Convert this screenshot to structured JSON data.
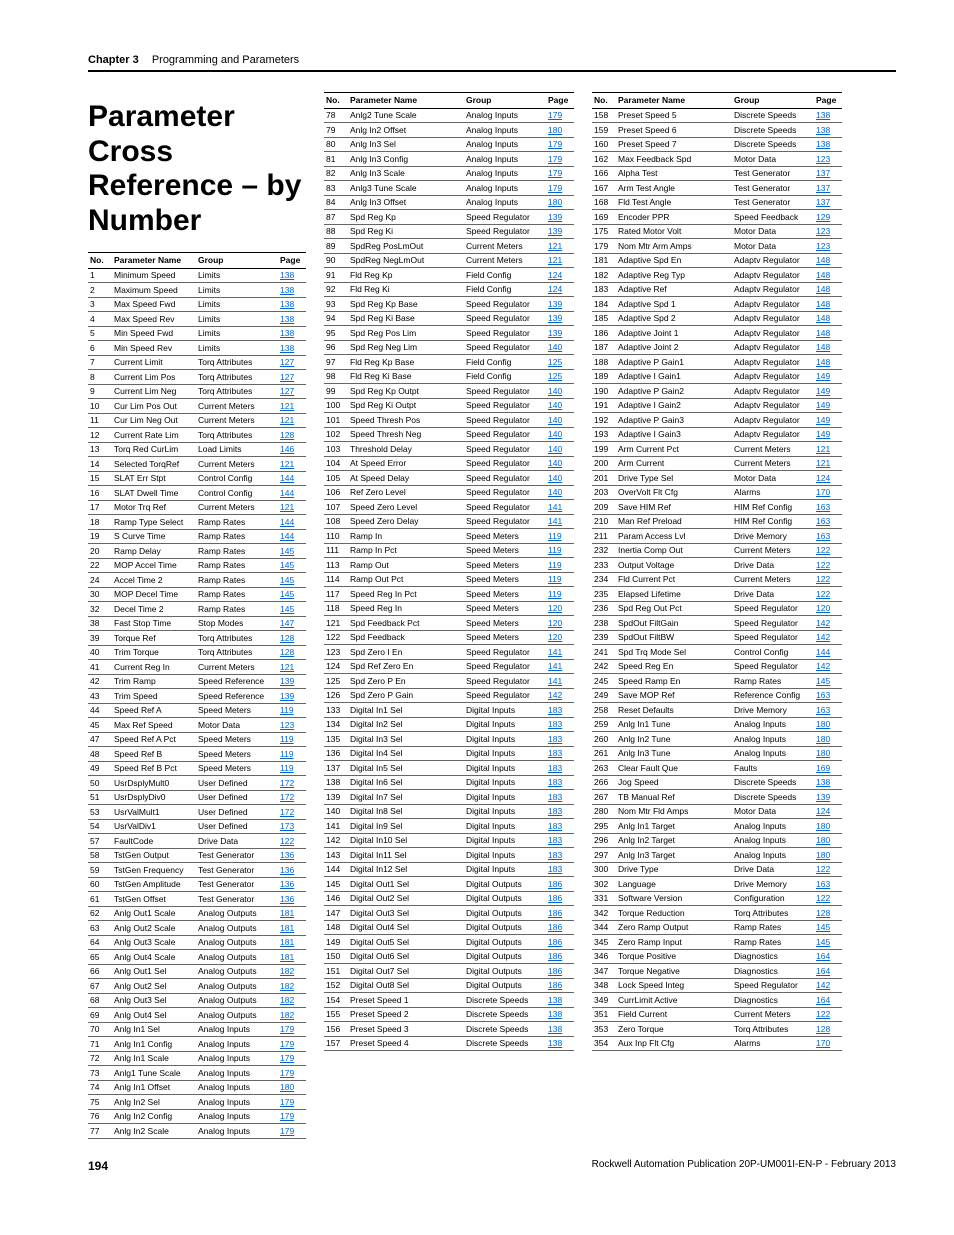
{
  "header": {
    "chapter": "Chapter 3",
    "section": "Programming and Parameters"
  },
  "title": "Parameter Cross Reference – by Number",
  "columns": {
    "no": "No.",
    "name": "Parameter Name",
    "group": "Group",
    "page": "Page"
  },
  "footer": {
    "page": "194",
    "pub": "Rockwell Automation Publication 20P-UM001I-EN-P - February 2013"
  },
  "tables": [
    [
      [
        "1",
        "Minimum Speed",
        "Limits",
        "138"
      ],
      [
        "2",
        "Maximum Speed",
        "Limits",
        "138"
      ],
      [
        "3",
        "Max Speed Fwd",
        "Limits",
        "138"
      ],
      [
        "4",
        "Max Speed Rev",
        "Limits",
        "138"
      ],
      [
        "5",
        "Min Speed Fwd",
        "Limits",
        "138"
      ],
      [
        "6",
        "Min Speed Rev",
        "Limits",
        "138"
      ],
      [
        "7",
        "Current Limit",
        "Torq Attributes",
        "127"
      ],
      [
        "8",
        "Current Lim Pos",
        "Torq Attributes",
        "127"
      ],
      [
        "9",
        "Current Lim Neg",
        "Torq Attributes",
        "127"
      ],
      [
        "10",
        "Cur Lim Pos Out",
        "Current Meters",
        "121"
      ],
      [
        "11",
        "Cur Lim Neg Out",
        "Current Meters",
        "121"
      ],
      [
        "12",
        "Current Rate Lim",
        "Torq Attributes",
        "128"
      ],
      [
        "13",
        "Torq Red CurLim",
        "Load Limits",
        "146"
      ],
      [
        "14",
        "Selected TorqRef",
        "Current Meters",
        "121"
      ],
      [
        "15",
        "SLAT Err Stpt",
        "Control Config",
        "144"
      ],
      [
        "16",
        "SLAT Dwell Time",
        "Control Config",
        "144"
      ],
      [
        "17",
        "Motor Trq Ref",
        "Current Meters",
        "121"
      ],
      [
        "18",
        "Ramp Type Select",
        "Ramp Rates",
        "144"
      ],
      [
        "19",
        "S Curve Time",
        "Ramp Rates",
        "144"
      ],
      [
        "20",
        "Ramp Delay",
        "Ramp Rates",
        "145"
      ],
      [
        "22",
        "MOP Accel Time",
        "Ramp Rates",
        "145"
      ],
      [
        "24",
        "Accel Time 2",
        "Ramp Rates",
        "145"
      ],
      [
        "30",
        "MOP Decel Time",
        "Ramp Rates",
        "145"
      ],
      [
        "32",
        "Decel Time 2",
        "Ramp Rates",
        "145"
      ],
      [
        "38",
        "Fast Stop Time",
        "Stop Modes",
        "147"
      ],
      [
        "39",
        "Torque Ref",
        "Torq Attributes",
        "128"
      ],
      [
        "40",
        "Trim Torque",
        "Torq Attributes",
        "128"
      ],
      [
        "41",
        "Current Reg In",
        "Current Meters",
        "121"
      ],
      [
        "42",
        "Trim Ramp",
        "Speed Reference",
        "139"
      ],
      [
        "43",
        "Trim Speed",
        "Speed Reference",
        "139"
      ],
      [
        "44",
        "Speed Ref A",
        "Speed Meters",
        "119"
      ],
      [
        "45",
        "Max Ref Speed",
        "Motor Data",
        "123"
      ],
      [
        "47",
        "Speed Ref A Pct",
        "Speed Meters",
        "119"
      ],
      [
        "48",
        "Speed Ref B",
        "Speed Meters",
        "119"
      ],
      [
        "49",
        "Speed Ref B Pct",
        "Speed Meters",
        "119"
      ],
      [
        "50",
        "UsrDsplyMult0",
        "User Defined",
        "172"
      ],
      [
        "51",
        "UsrDsplyDiv0",
        "User Defined",
        "172"
      ],
      [
        "53",
        "UsrValMult1",
        "User Defined",
        "172"
      ],
      [
        "54",
        "UsrValDiv1",
        "User Defined",
        "173"
      ],
      [
        "57",
        "FaultCode",
        "Drive Data",
        "122"
      ],
      [
        "58",
        "TstGen Output",
        "Test Generator",
        "136"
      ],
      [
        "59",
        "TstGen Frequency",
        "Test Generator",
        "136"
      ],
      [
        "60",
        "TstGen Amplitude",
        "Test Generator",
        "136"
      ],
      [
        "61",
        "TstGen Offset",
        "Test Generator",
        "136"
      ],
      [
        "62",
        "Anlg Out1 Scale",
        "Analog Outputs",
        "181"
      ],
      [
        "63",
        "Anlg Out2 Scale",
        "Analog Outputs",
        "181"
      ],
      [
        "64",
        "Anlg Out3 Scale",
        "Analog Outputs",
        "181"
      ],
      [
        "65",
        "Anlg Out4 Scale",
        "Analog Outputs",
        "181"
      ],
      [
        "66",
        "Anlg Out1 Sel",
        "Analog Outputs",
        "182"
      ],
      [
        "67",
        "Anlg Out2 Sel",
        "Analog Outputs",
        "182"
      ],
      [
        "68",
        "Anlg Out3 Sel",
        "Analog Outputs",
        "182"
      ],
      [
        "69",
        "Anlg Out4 Sel",
        "Analog Outputs",
        "182"
      ],
      [
        "70",
        "Anlg In1 Sel",
        "Analog Inputs",
        "179"
      ],
      [
        "71",
        "Anlg In1 Config",
        "Analog Inputs",
        "179"
      ],
      [
        "72",
        "Anlg In1 Scale",
        "Analog Inputs",
        "179"
      ],
      [
        "73",
        "Anlg1 Tune Scale",
        "Analog Inputs",
        "179"
      ],
      [
        "74",
        "Anlg In1 Offset",
        "Analog Inputs",
        "180"
      ],
      [
        "75",
        "Anlg In2 Sel",
        "Analog Inputs",
        "179"
      ],
      [
        "76",
        "Anlg In2 Config",
        "Analog Inputs",
        "179"
      ],
      [
        "77",
        "Anlg In2 Scale",
        "Analog Inputs",
        "179"
      ]
    ],
    [
      [
        "78",
        "Anlg2 Tune Scale",
        "Analog Inputs",
        "179"
      ],
      [
        "79",
        "Anlg In2 Offset",
        "Analog Inputs",
        "180"
      ],
      [
        "80",
        "Anlg In3 Sel",
        "Analog Inputs",
        "179"
      ],
      [
        "81",
        "Anlg In3 Config",
        "Analog Inputs",
        "179"
      ],
      [
        "82",
        "Anlg In3 Scale",
        "Analog Inputs",
        "179"
      ],
      [
        "83",
        "Anlg3 Tune Scale",
        "Analog Inputs",
        "179"
      ],
      [
        "84",
        "Anlg In3 Offset",
        "Analog Inputs",
        "180"
      ],
      [
        "87",
        "Spd Reg Kp",
        "Speed Regulator",
        "139"
      ],
      [
        "88",
        "Spd Reg Ki",
        "Speed Regulator",
        "139"
      ],
      [
        "89",
        "SpdReg PosLmOut",
        "Current Meters",
        "121"
      ],
      [
        "90",
        "SpdReg NegLmOut",
        "Current Meters",
        "121"
      ],
      [
        "91",
        "Fld Reg Kp",
        "Field Config",
        "124"
      ],
      [
        "92",
        "Fld Reg Ki",
        "Field Config",
        "124"
      ],
      [
        "93",
        "Spd Reg Kp Base",
        "Speed Regulator",
        "139"
      ],
      [
        "94",
        "Spd Reg Ki Base",
        "Speed Regulator",
        "139"
      ],
      [
        "95",
        "Spd Reg Pos Lim",
        "Speed Regulator",
        "139"
      ],
      [
        "96",
        "Spd Reg Neg Lim",
        "Speed Regulator",
        "140"
      ],
      [
        "97",
        "Fld Reg Kp Base",
        "Field Config",
        "125"
      ],
      [
        "98",
        "Fld Reg Ki Base",
        "Field Config",
        "125"
      ],
      [
        "99",
        "Spd Reg Kp Outpt",
        "Speed Regulator",
        "140"
      ],
      [
        "100",
        "Spd Reg Ki Outpt",
        "Speed Regulator",
        "140"
      ],
      [
        "101",
        "Speed Thresh Pos",
        "Speed Regulator",
        "140"
      ],
      [
        "102",
        "Speed Thresh Neg",
        "Speed Regulator",
        "140"
      ],
      [
        "103",
        "Threshold Delay",
        "Speed Regulator",
        "140"
      ],
      [
        "104",
        "At Speed Error",
        "Speed Regulator",
        "140"
      ],
      [
        "105",
        "At Speed Delay",
        "Speed Regulator",
        "140"
      ],
      [
        "106",
        "Ref Zero Level",
        "Speed Regulator",
        "140"
      ],
      [
        "107",
        "Speed Zero Level",
        "Speed Regulator",
        "141"
      ],
      [
        "108",
        "Speed Zero Delay",
        "Speed Regulator",
        "141"
      ],
      [
        "110",
        "Ramp In",
        "Speed Meters",
        "119"
      ],
      [
        "111",
        "Ramp In Pct",
        "Speed Meters",
        "119"
      ],
      [
        "113",
        "Ramp Out",
        "Speed Meters",
        "119"
      ],
      [
        "114",
        "Ramp Out Pct",
        "Speed Meters",
        "119"
      ],
      [
        "117",
        "Speed Reg In Pct",
        "Speed Meters",
        "119"
      ],
      [
        "118",
        "Speed Reg In",
        "Speed Meters",
        "120"
      ],
      [
        "121",
        "Spd Feedback Pct",
        "Speed Meters",
        "120"
      ],
      [
        "122",
        "Spd Feedback",
        "Speed Meters",
        "120"
      ],
      [
        "123",
        "Spd Zero I En",
        "Speed Regulator",
        "141"
      ],
      [
        "124",
        "Spd Ref Zero En",
        "Speed Regulator",
        "141"
      ],
      [
        "125",
        "Spd Zero P En",
        "Speed Regulator",
        "141"
      ],
      [
        "126",
        "Spd Zero P Gain",
        "Speed Regulator",
        "142"
      ],
      [
        "133",
        "Digital In1 Sel",
        "Digital Inputs",
        "183"
      ],
      [
        "134",
        "Digital In2 Sel",
        "Digital Inputs",
        "183"
      ],
      [
        "135",
        "Digital In3 Sel",
        "Digital Inputs",
        "183"
      ],
      [
        "136",
        "Digital In4 Sel",
        "Digital Inputs",
        "183"
      ],
      [
        "137",
        "Digital In5 Sel",
        "Digital Inputs",
        "183"
      ],
      [
        "138",
        "Digital In6 Sel",
        "Digital Inputs",
        "183"
      ],
      [
        "139",
        "Digital In7 Sel",
        "Digital Inputs",
        "183"
      ],
      [
        "140",
        "Digital In8 Sel",
        "Digital Inputs",
        "183"
      ],
      [
        "141",
        "Digital In9 Sel",
        "Digital Inputs",
        "183"
      ],
      [
        "142",
        "Digital In10 Sel",
        "Digital Inputs",
        "183"
      ],
      [
        "143",
        "Digital In11 Sel",
        "Digital Inputs",
        "183"
      ],
      [
        "144",
        "Digital In12 Sel",
        "Digital Inputs",
        "183"
      ],
      [
        "145",
        "Digital Out1 Sel",
        "Digital Outputs",
        "186"
      ],
      [
        "146",
        "Digital Out2 Sel",
        "Digital Outputs",
        "186"
      ],
      [
        "147",
        "Digital Out3 Sel",
        "Digital Outputs",
        "186"
      ],
      [
        "148",
        "Digital Out4 Sel",
        "Digital Outputs",
        "186"
      ],
      [
        "149",
        "Digital Out5 Sel",
        "Digital Outputs",
        "186"
      ],
      [
        "150",
        "Digital Out6 Sel",
        "Digital Outputs",
        "186"
      ],
      [
        "151",
        "Digital Out7 Sel",
        "Digital Outputs",
        "186"
      ],
      [
        "152",
        "Digital Out8 Sel",
        "Digital Outputs",
        "186"
      ],
      [
        "154",
        "Preset Speed 1",
        "Discrete Speeds",
        "138"
      ],
      [
        "155",
        "Preset Speed 2",
        "Discrete Speeds",
        "138"
      ],
      [
        "156",
        "Preset Speed 3",
        "Discrete Speeds",
        "138"
      ],
      [
        "157",
        "Preset Speed 4",
        "Discrete Speeds",
        "138"
      ]
    ],
    [
      [
        "158",
        "Preset Speed 5",
        "Discrete Speeds",
        "138"
      ],
      [
        "159",
        "Preset Speed 6",
        "Discrete Speeds",
        "138"
      ],
      [
        "160",
        "Preset Speed 7",
        "Discrete Speeds",
        "138"
      ],
      [
        "162",
        "Max Feedback Spd",
        "Motor Data",
        "123"
      ],
      [
        "166",
        "Alpha Test",
        "Test Generator",
        "137"
      ],
      [
        "167",
        "Arm Test Angle",
        "Test Generator",
        "137"
      ],
      [
        "168",
        "Fld Test Angle",
        "Test Generator",
        "137"
      ],
      [
        "169",
        "Encoder PPR",
        "Speed Feedback",
        "129"
      ],
      [
        "175",
        "Rated Motor Volt",
        "Motor Data",
        "123"
      ],
      [
        "179",
        "Nom Mtr Arm Amps",
        "Motor Data",
        "123"
      ],
      [
        "181",
        "Adaptive Spd En",
        "Adaptv Regulator",
        "148"
      ],
      [
        "182",
        "Adaptive Reg Typ",
        "Adaptv Regulator",
        "148"
      ],
      [
        "183",
        "Adaptive Ref",
        "Adaptv Regulator",
        "148"
      ],
      [
        "184",
        "Adaptive Spd 1",
        "Adaptv Regulator",
        "148"
      ],
      [
        "185",
        "Adaptive Spd 2",
        "Adaptv Regulator",
        "148"
      ],
      [
        "186",
        "Adaptive Joint 1",
        "Adaptv Regulator",
        "148"
      ],
      [
        "187",
        "Adaptive Joint 2",
        "Adaptv Regulator",
        "148"
      ],
      [
        "188",
        "Adaptive P Gain1",
        "Adaptv Regulator",
        "148"
      ],
      [
        "189",
        "Adaptive I Gain1",
        "Adaptv Regulator",
        "149"
      ],
      [
        "190",
        "Adaptive P Gain2",
        "Adaptv Regulator",
        "149"
      ],
      [
        "191",
        "Adaptive I Gain2",
        "Adaptv Regulator",
        "149"
      ],
      [
        "192",
        "Adaptive P Gain3",
        "Adaptv Regulator",
        "149"
      ],
      [
        "193",
        "Adaptive I Gain3",
        "Adaptv Regulator",
        "149"
      ],
      [
        "199",
        "Arm Current Pct",
        "Current Meters",
        "121"
      ],
      [
        "200",
        "Arm Current",
        "Current Meters",
        "121"
      ],
      [
        "201",
        "Drive Type Sel",
        "Motor Data",
        "124"
      ],
      [
        "203",
        "OverVolt Flt Cfg",
        "Alarms",
        "170"
      ],
      [
        "209",
        "Save HIM Ref",
        "HIM Ref Config",
        "163"
      ],
      [
        "210",
        "Man Ref Preload",
        "HIM Ref Config",
        "163"
      ],
      [
        "211",
        "Param Access Lvl",
        "Drive Memory",
        "163"
      ],
      [
        "232",
        "Inertia Comp Out",
        "Current Meters",
        "122"
      ],
      [
        "233",
        "Output Voltage",
        "Drive Data",
        "122"
      ],
      [
        "234",
        "Fld Current Pct",
        "Current Meters",
        "122"
      ],
      [
        "235",
        "Elapsed Lifetime",
        "Drive Data",
        "122"
      ],
      [
        "236",
        "Spd Reg Out Pct",
        "Speed Regulator",
        "120"
      ],
      [
        "238",
        "SpdOut FiltGain",
        "Speed Regulator",
        "142"
      ],
      [
        "239",
        "SpdOut FiltBW",
        "Speed Regulator",
        "142"
      ],
      [
        "241",
        "Spd Trq Mode Sel",
        "Control Config",
        "144"
      ],
      [
        "242",
        "Speed Reg En",
        "Speed Regulator",
        "142"
      ],
      [
        "245",
        "Speed Ramp En",
        "Ramp Rates",
        "145"
      ],
      [
        "249",
        "Save MOP Ref",
        "Reference Config",
        "163"
      ],
      [
        "258",
        "Reset Defaults",
        "Drive Memory",
        "163"
      ],
      [
        "259",
        "Anlg In1 Tune",
        "Analog Inputs",
        "180"
      ],
      [
        "260",
        "Anlg In2 Tune",
        "Analog Inputs",
        "180"
      ],
      [
        "261",
        "Anlg In3 Tune",
        "Analog Inputs",
        "180"
      ],
      [
        "263",
        "Clear Fault Que",
        "Faults",
        "169"
      ],
      [
        "266",
        "Jog Speed",
        "Discrete Speeds",
        "138"
      ],
      [
        "267",
        "TB Manual Ref",
        "Discrete Speeds",
        "139"
      ],
      [
        "280",
        "Nom Mtr Fld Amps",
        "Motor Data",
        "124"
      ],
      [
        "295",
        "Anlg In1 Target",
        "Analog Inputs",
        "180"
      ],
      [
        "296",
        "Anlg In2 Target",
        "Analog Inputs",
        "180"
      ],
      [
        "297",
        "Anlg In3 Target",
        "Analog Inputs",
        "180"
      ],
      [
        "300",
        "Drive Type",
        "Drive Data",
        "122"
      ],
      [
        "302",
        "Language",
        "Drive Memory",
        "163"
      ],
      [
        "331",
        "Software Version",
        "Configuration",
        "122"
      ],
      [
        "342",
        "Torque Reduction",
        "Torq Attributes",
        "128"
      ],
      [
        "344",
        "Zero Ramp Output",
        "Ramp Rates",
        "145"
      ],
      [
        "345",
        "Zero Ramp Input",
        "Ramp Rates",
        "145"
      ],
      [
        "346",
        "Torque Positive",
        "Diagnostics",
        "164"
      ],
      [
        "347",
        "Torque Negative",
        "Diagnostics",
        "164"
      ],
      [
        "348",
        "Lock Speed Integ",
        "Speed Regulator",
        "142"
      ],
      [
        "349",
        "CurrLimit Active",
        "Diagnostics",
        "164"
      ],
      [
        "351",
        "Field Current",
        "Current Meters",
        "122"
      ],
      [
        "353",
        "Zero Torque",
        "Torq Attributes",
        "128"
      ],
      [
        "354",
        "Aux Inp Flt Cfg",
        "Alarms",
        "170"
      ]
    ]
  ]
}
